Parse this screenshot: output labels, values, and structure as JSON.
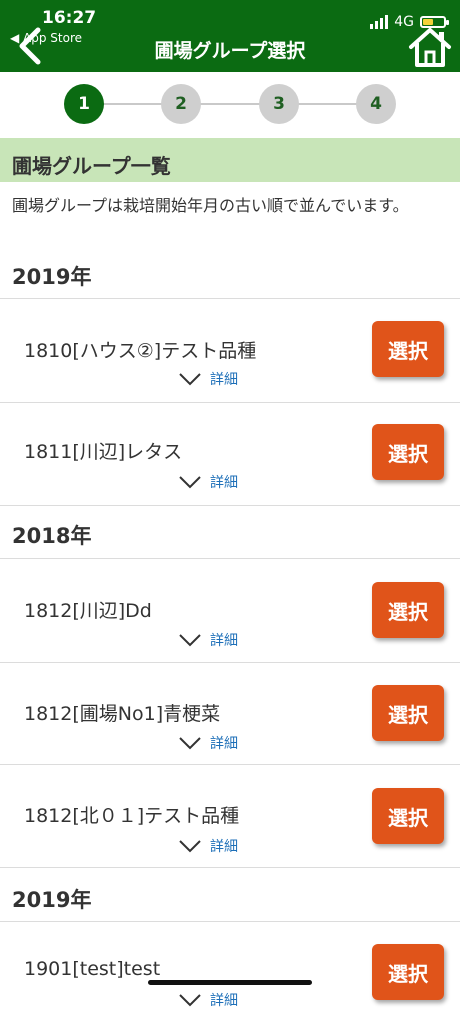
{
  "status": {
    "time": "16:27",
    "back_app": "◀ App Store",
    "network": "4G",
    "battery_level": 0.45
  },
  "header": {
    "title": "圃場グループ選択"
  },
  "steps": [
    "1",
    "2",
    "3",
    "4"
  ],
  "active_step": 1,
  "section": {
    "title": "圃場グループ一覧",
    "note": "圃場グループは栽培開始年月の古い順で並んでいます。"
  },
  "groups": [
    {
      "year": "2019年",
      "items": [
        {
          "name": "1810[ハウス②]テスト品種",
          "detail": "詳細",
          "button": "選択"
        },
        {
          "name": "1811[川辺]レタス",
          "detail": "詳細",
          "button": "選択"
        }
      ]
    },
    {
      "year": "2018年",
      "items": [
        {
          "name": "1812[川辺]Dd",
          "detail": "詳細",
          "button": "選択"
        },
        {
          "name": "1812[圃場No1]青梗菜",
          "detail": "詳細",
          "button": "選択"
        },
        {
          "name": "1812[北０１]テスト品種",
          "detail": "詳細",
          "button": "選択"
        }
      ]
    },
    {
      "year": "2019年",
      "items": [
        {
          "name": "1901[test]test",
          "detail": "詳細",
          "button": "選択"
        }
      ]
    }
  ]
}
